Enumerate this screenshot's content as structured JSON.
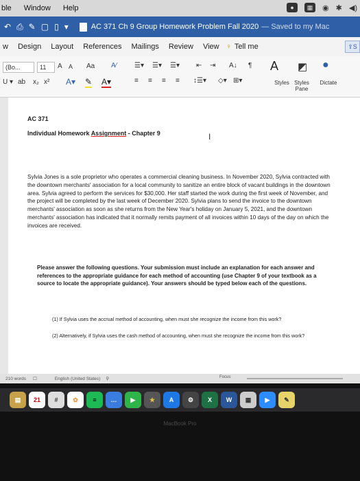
{
  "menubar": {
    "items": [
      "ble",
      "Window",
      "Help"
    ]
  },
  "titlebar": {
    "doc_title": "AC 371 Ch 9 Group Homework Problem Fall 2020",
    "saved": "— Saved to my Mac"
  },
  "ribbon_tabs": [
    "w",
    "Design",
    "Layout",
    "References",
    "Mailings",
    "Review",
    "View",
    "Tell me"
  ],
  "ribbon": {
    "font_name": "(Bo...",
    "font_size": "11",
    "grow_font": "A",
    "shrink_font": "A",
    "change_case": "Aa",
    "styles": "Styles",
    "styles_pane": "Styles Pane",
    "dictate": "Dictate"
  },
  "document": {
    "course": "AC 371",
    "heading_prefix": "Individual Homework ",
    "heading_underlined": "Assignment",
    "heading_suffix": " - Chapter 9",
    "paragraph": "Sylvia Jones is a sole proprietor who operates a commercial cleaning business. In November 2020, Sylvia contracted with the downtown merchants' association for a local community to sanitize an entire block of vacant buildings in the downtown area. Sylvia agreed to perform the services for $30,000. Her staff started the work during the first week of November, and the project will be completed by the last week of December 2020. Sylvia plans to send the invoice to the downtown merchants' association as soon as she returns from the New Year's holiday on January 5, 2021, and the downtown merchants' association has indicated that it normally remits payment of all invoices within 10 days of the day on which the invoices are received.",
    "instructions": "Please answer the following questions. Your submission must include an explanation for each answer and references to the appropriate guidance for each method of accounting (use Chapter 9 of your textbook as a source to locate the appropriate guidance). Your answers should be typed below each of the questions.",
    "questions": [
      "(1) If Sylvia uses the accrual method of accounting, when must she recognize the income from this work?",
      "(2) Alternatively, if Sylvia uses the cash method of accounting, when must she recognize the income from this work?"
    ]
  },
  "statusbar": {
    "word_count": "210 words",
    "language": "English (United States)",
    "focus": "Focus"
  },
  "dock": {
    "calendar_day": "21",
    "word_label": "W",
    "excel_label": "X"
  },
  "laptop_label": "MacBook Pro",
  "colors": {
    "title_bar": "#2f5fa6",
    "ribbon_bg": "#f3f3f3",
    "accent_blue": "#2f5fa6"
  }
}
